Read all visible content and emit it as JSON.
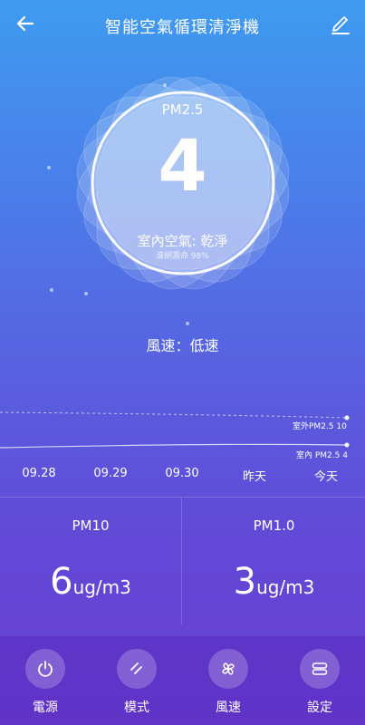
{
  "header": {
    "title": "智能空氣循環清淨機"
  },
  "gauge": {
    "label": "PM2.5",
    "value": "4",
    "air_quality": "室內空氣: 乾淨",
    "filter_life": "濾網壽命 98%"
  },
  "fan": {
    "speed_text": "風速：低速"
  },
  "chart": {
    "outdoor_label": "室外PM2.5 10",
    "indoor_label": "室內 PM2.5 4",
    "dates": [
      "09.28",
      "09.29",
      "09.30",
      "昨天",
      "今天"
    ]
  },
  "stats": {
    "pm10": {
      "label": "PM10",
      "value": "6",
      "unit": "ug/m3"
    },
    "pm1": {
      "label": "PM1.0",
      "value": "3",
      "unit": "ug/m3"
    }
  },
  "nav": [
    {
      "label": "電源",
      "icon": "power-icon"
    },
    {
      "label": "模式",
      "icon": "mode-icon"
    },
    {
      "label": "風速",
      "icon": "fan-icon"
    },
    {
      "label": "設定",
      "icon": "settings-icon"
    }
  ],
  "colors": {
    "accent": "#3f9bf0",
    "primary": "#6a3fd2"
  }
}
